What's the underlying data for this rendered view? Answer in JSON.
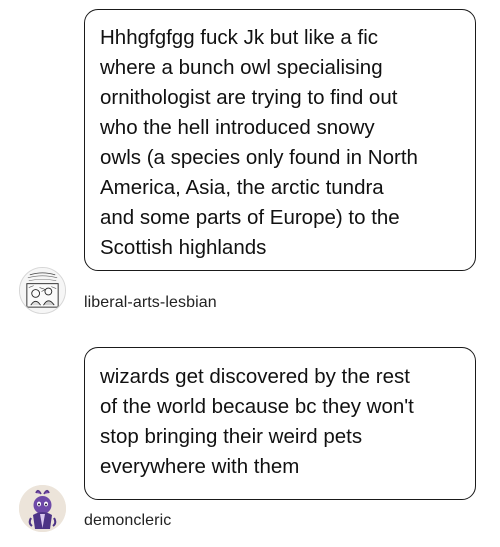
{
  "messages": [
    {
      "text": "Hhhgfgfgg fuck Jk but like a fic\nwhere a bunch owl specialising\nornithologist are trying to find out\nwho the hell introduced snowy\nowls (a species only found in North\nAmerica, Asia, the arctic tundra\nand some parts of Europe) to the\nScottish highlands",
      "username": "liberal-arts-lesbian",
      "avatar_icon": "comic-panel-avatar"
    },
    {
      "text": "wizards get discovered by the rest\nof the world because bc they won't\nstop bringing their weird pets\neverywhere with them",
      "username": "demoncleric",
      "avatar_icon": "purple-creature-avatar"
    }
  ]
}
